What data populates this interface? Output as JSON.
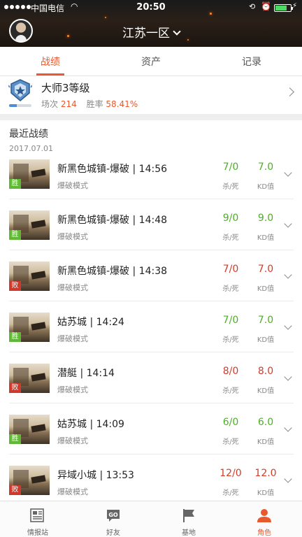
{
  "status_bar": {
    "carrier": "中国电信",
    "time": "20:50",
    "battery_level": 0.8
  },
  "header": {
    "server_name": "江苏一区"
  },
  "tabs": [
    {
      "label": "战绩",
      "active": true
    },
    {
      "label": "资产",
      "active": false
    },
    {
      "label": "记录",
      "active": false
    }
  ],
  "rank": {
    "name": "大师3等级",
    "matches_label": "场次",
    "matches_value": "214",
    "winrate_label": "胜率",
    "winrate_value": "58.41%",
    "progress": 0.35
  },
  "recent": {
    "title": "最近战绩",
    "date": "2017.07.01",
    "kd_label": "杀/死",
    "ratio_label": "KD值",
    "matches": [
      {
        "result": "胜",
        "outcome": "win",
        "map": "新黑色城镇-爆破 | 14:56",
        "mode": "爆破模式",
        "kd": "7/0",
        "ratio": "7.0"
      },
      {
        "result": "胜",
        "outcome": "win",
        "map": "新黑色城镇-爆破 | 14:48",
        "mode": "爆破模式",
        "kd": "9/0",
        "ratio": "9.0"
      },
      {
        "result": "败",
        "outcome": "lose",
        "map": "新黑色城镇-爆破 | 14:38",
        "mode": "爆破模式",
        "kd": "7/0",
        "ratio": "7.0"
      },
      {
        "result": "胜",
        "outcome": "win",
        "map": "姑苏城 | 14:24",
        "mode": "爆破模式",
        "kd": "7/0",
        "ratio": "7.0"
      },
      {
        "result": "败",
        "outcome": "lose",
        "map": "潜艇 | 14:14",
        "mode": "爆破模式",
        "kd": "8/0",
        "ratio": "8.0"
      },
      {
        "result": "胜",
        "outcome": "win",
        "map": "姑苏城 | 14:09",
        "mode": "爆破模式",
        "kd": "6/0",
        "ratio": "6.0"
      },
      {
        "result": "败",
        "outcome": "lose",
        "map": "异域小城 | 13:53",
        "mode": "爆破模式",
        "kd": "12/0",
        "ratio": "12.0"
      }
    ]
  },
  "tabbar": [
    {
      "label": "情报站",
      "icon": "news-icon",
      "active": false
    },
    {
      "label": "好友",
      "icon": "go-icon",
      "active": false
    },
    {
      "label": "基地",
      "icon": "flag-icon",
      "active": false
    },
    {
      "label": "角色",
      "icon": "person-icon",
      "active": true
    }
  ],
  "colors": {
    "accent": "#e8592e",
    "win": "#5fb934",
    "lose": "#d0392b",
    "kd_win": "#4fae28",
    "kd_lose": "#d33b2c"
  }
}
